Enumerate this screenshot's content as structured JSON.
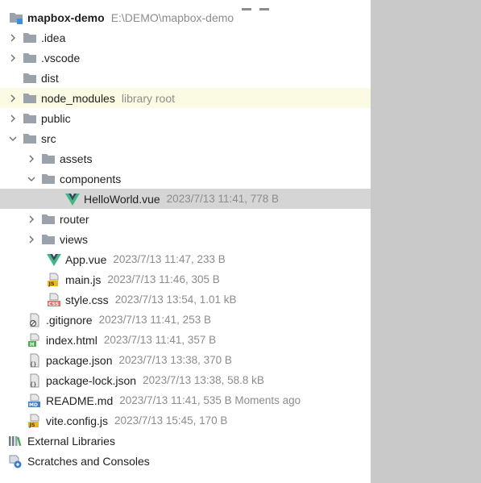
{
  "project": {
    "name": "mapbox-demo",
    "path": "E:\\DEMO\\mapbox-demo"
  },
  "tree": {
    "idea": ".idea",
    "vscode": ".vscode",
    "dist": "dist",
    "node_modules": {
      "name": "node_modules",
      "hint": "library root"
    },
    "public": "public",
    "src": "src",
    "assets": "assets",
    "components": "components",
    "helloworld": {
      "name": "HelloWorld.vue",
      "meta": "2023/7/13 11:41, 778 B"
    },
    "router": "router",
    "views": "views",
    "app_vue": {
      "name": "App.vue",
      "meta": "2023/7/13 11:47, 233 B"
    },
    "main_js": {
      "name": "main.js",
      "meta": "2023/7/13 11:46, 305 B"
    },
    "style_css": {
      "name": "style.css",
      "meta": "2023/7/13 13:54, 1.01 kB"
    },
    "gitignore": {
      "name": ".gitignore",
      "meta": "2023/7/13 11:41, 253 B"
    },
    "index_html": {
      "name": "index.html",
      "meta": "2023/7/13 11:41, 357 B"
    },
    "package_json": {
      "name": "package.json",
      "meta": "2023/7/13 13:38, 370 B"
    },
    "package_lock": {
      "name": "package-lock.json",
      "meta": "2023/7/13 13:38, 58.8 kB"
    },
    "readme": {
      "name": "README.md",
      "meta": "2023/7/13 11:41, 535 B Moments ago"
    },
    "vite_config": {
      "name": "vite.config.js",
      "meta": "2023/7/13 15:45, 170 B"
    },
    "external_libraries": "External Libraries",
    "scratches": "Scratches and Consoles"
  },
  "icons": {
    "folder": "folder-icon",
    "vue": "vue-icon",
    "js": "js-file-icon",
    "css": "css-file-icon",
    "html": "html-file-icon",
    "json": "json-file-icon",
    "markdown": "markdown-file-icon",
    "gitignore": "gitignore-file-icon",
    "libraries": "external-libraries-icon",
    "scratches": "scratches-icon"
  },
  "colors": {
    "folder": "#9aa3ab",
    "vue_green": "#41b883",
    "vue_dark": "#35495e",
    "selected_row": "#d5d5d5",
    "library_root_row": "#fbfbe3",
    "muted_text": "#8c8c8c",
    "gutter": "#c9c9c9"
  }
}
